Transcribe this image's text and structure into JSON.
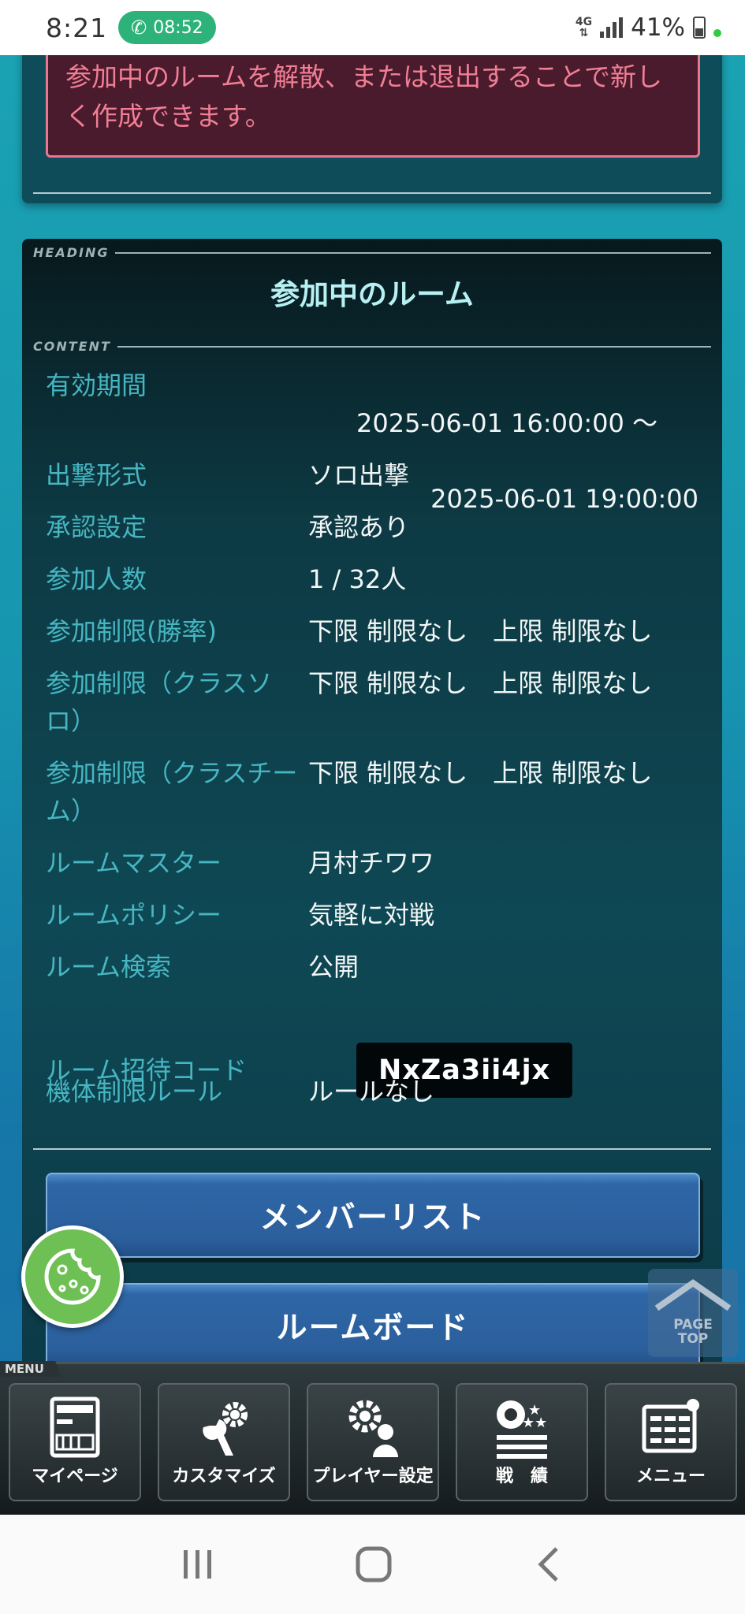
{
  "status_bar": {
    "time": "8:21",
    "call_duration": "08:52",
    "network": "4G",
    "battery": "41%"
  },
  "notice": {
    "text": "参加中のルームを解散、または退出することで新しく作成できます。"
  },
  "panel": {
    "heading_tag": "HEADING",
    "content_tag": "CONTENT",
    "title": "参加中のルーム",
    "rows": {
      "period": {
        "label": "有効期間",
        "value1": "2025-06-01 16:00:00 ～",
        "value2": "2025-06-01 19:00:00"
      },
      "sortie": {
        "label": "出撃形式",
        "value": "ソロ出撃"
      },
      "approval": {
        "label": "承認設定",
        "value": "承認あり"
      },
      "members": {
        "label": "参加人数",
        "value": "1 / 32人"
      },
      "winrate": {
        "label": "参加制限(勝率)",
        "value": "下限 制限なし　上限 制限なし"
      },
      "class_solo": {
        "label": "参加制限（クラスソロ）",
        "value": "下限 制限なし　上限 制限なし"
      },
      "class_team": {
        "label": "参加制限（クラスチーム）",
        "value": "下限 制限なし　上限 制限なし"
      },
      "master": {
        "label": "ルームマスター",
        "value": "月村チワワ"
      },
      "policy": {
        "label": "ルームポリシー",
        "value": "気軽に対戦"
      },
      "search": {
        "label": "ルーム検索",
        "value": "公開"
      },
      "invite": {
        "label": "ルーム招待コード",
        "value": "NxZa3ii4jx"
      },
      "machine": {
        "label": "機体制限ルール",
        "value": "ルールなし"
      }
    }
  },
  "buttons": {
    "member_list": "メンバーリスト",
    "room_board": "ルームボード"
  },
  "page_top": {
    "line1": "PAGE",
    "line2": "TOP"
  },
  "menu": {
    "tab": "MENU",
    "items": [
      "マイページ",
      "カスタマイズ",
      "プレイヤー設定",
      "戦　績",
      "メニュー"
    ]
  }
}
